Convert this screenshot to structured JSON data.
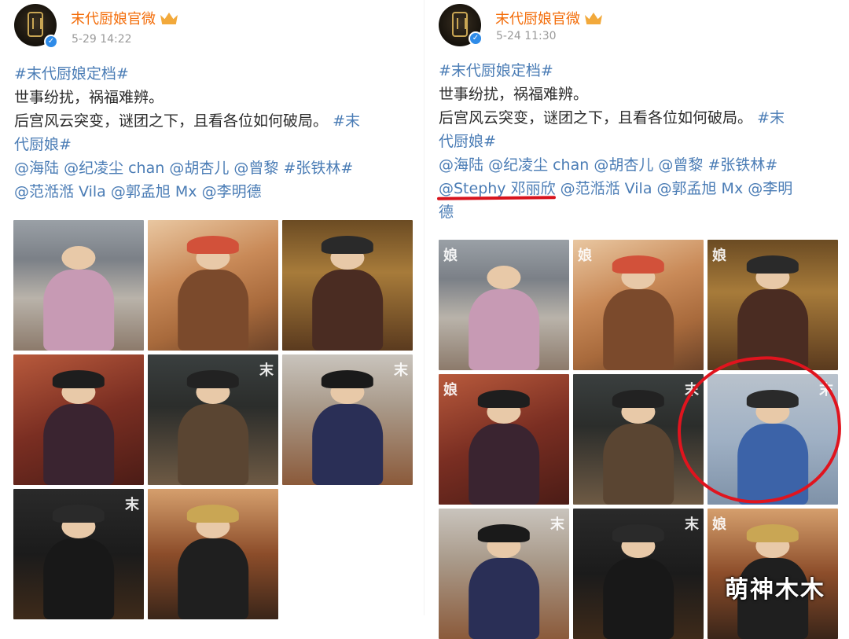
{
  "left_post": {
    "username": "末代厨娘官微",
    "timestamp": "5-29 14:22",
    "lines": {
      "l1_tag": "#末代厨娘定档#",
      "l2": "世事纷扰，祸福难辨。",
      "l3_text": "后宫风云突变，谜团之下，且看各位如何破局。",
      "l3_tag": "#末",
      "l4_tag": "代厨娘#",
      "l5_m1": "@海陆",
      "l5_m2": "@纪凌尘 chan",
      "l5_m3": "@胡杏儿",
      "l5_m4": "@曾黎",
      "l5_tag": "#张铁林#",
      "l6_m1": "@范湉湉 Vila",
      "l6_m2": "@郭孟旭 Mx",
      "l6_m3": "@李明德"
    }
  },
  "right_post": {
    "username": "末代厨娘官微",
    "timestamp": "5-24 11:30",
    "lines": {
      "l1_tag": "#末代厨娘定档#",
      "l2": "世事纷扰，祸福难辨。",
      "l3_text": "后宫风云突变，谜团之下，且看各位如何破局。",
      "l3_tag": "#末",
      "l4_tag": "代厨娘#",
      "l5_m1": "@海陆",
      "l5_m2": "@纪凌尘 chan",
      "l5_m3": "@胡杏儿",
      "l5_m4": "@曾黎",
      "l5_tag": "#张铁林#",
      "l6_m1": "@Stephy 邓丽欣",
      "l6_m2": "@范湉湉 Vila",
      "l6_m3": "@郭孟旭 Mx",
      "l6_m4": "@李明",
      "l7_m": "德"
    }
  },
  "overlay_watermark": "萌神木木",
  "colors": {
    "username": "#f36d0a",
    "link": "#4a7cb5",
    "highlight": "#e0141e",
    "verified": "#2e8be8"
  }
}
